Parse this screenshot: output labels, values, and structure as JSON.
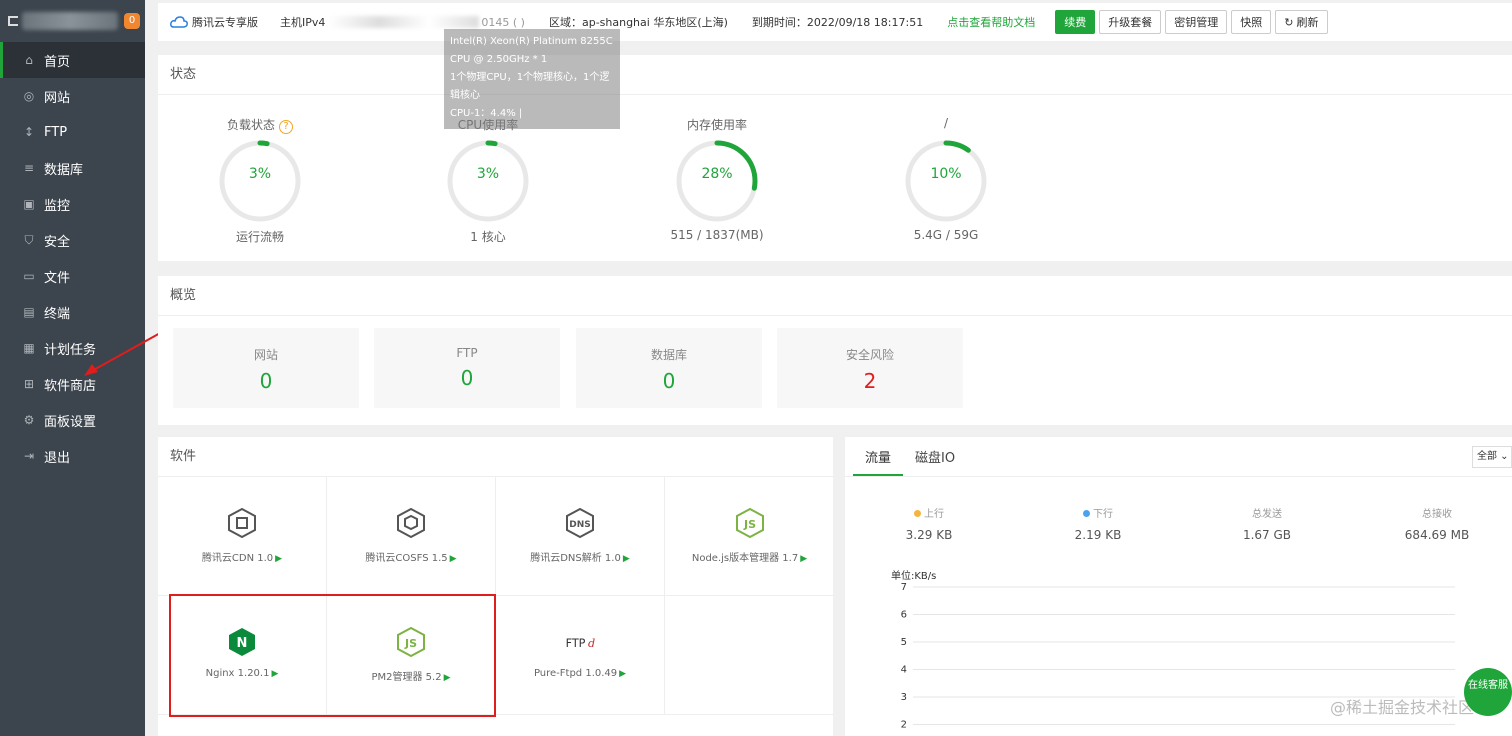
{
  "sidebar": {
    "badge": "0",
    "items": [
      {
        "label": "首页",
        "icon": "home-icon",
        "active": true
      },
      {
        "label": "网站",
        "icon": "globe-icon"
      },
      {
        "label": "FTP",
        "icon": "ftp-icon"
      },
      {
        "label": "数据库",
        "icon": "database-icon"
      },
      {
        "label": "监控",
        "icon": "monitor-icon"
      },
      {
        "label": "安全",
        "icon": "shield-icon"
      },
      {
        "label": "文件",
        "icon": "folder-icon"
      },
      {
        "label": "终端",
        "icon": "terminal-icon"
      },
      {
        "label": "计划任务",
        "icon": "calendar-icon"
      },
      {
        "label": "软件商店",
        "icon": "grid-icon"
      },
      {
        "label": "面板设置",
        "icon": "gear-icon"
      },
      {
        "label": "退出",
        "icon": "logout-icon"
      }
    ]
  },
  "topbar": {
    "version": "腾讯云专享版",
    "ip_label": "主机IPv4",
    "ip_tail": "0145 (        )",
    "region": "区域：ap-shanghai 华东地区(上海)",
    "expire": "到期时间：2022/09/18 18:17:51",
    "help": "点击查看帮助文档",
    "buttons": [
      "续费",
      "升级套餐",
      "密钥管理",
      "快照",
      "刷新"
    ]
  },
  "status": {
    "title": "状态",
    "gauges": [
      {
        "label": "负载状态",
        "value": "3%",
        "percent": 3,
        "sub": "运行流畅",
        "help": "?"
      },
      {
        "label": "CPU使用率",
        "value": "3%",
        "percent": 3,
        "sub": "1 核心"
      },
      {
        "label": "内存使用率",
        "value": "28%",
        "percent": 28,
        "sub": "515 / 1837(MB)"
      },
      {
        "label": "/",
        "value": "10%",
        "percent": 10,
        "sub": "5.4G / 59G"
      }
    ],
    "tooltip": [
      "Intel(R) Xeon(R) Platinum 8255C",
      "CPU @ 2.50GHz * 1",
      "1个物理CPU，1个物理核心，1个逻",
      "辑核心",
      "CPU-1：4.4% |"
    ]
  },
  "overview": {
    "title": "概览",
    "cards": [
      {
        "label": "网站",
        "value": "0"
      },
      {
        "label": "FTP",
        "value": "0"
      },
      {
        "label": "数据库",
        "value": "0"
      },
      {
        "label": "安全风险",
        "value": "2",
        "danger": true
      }
    ]
  },
  "software": {
    "title": "软件",
    "items": [
      {
        "name": "腾讯云CDN 1.0",
        "icon": "cdn-icon"
      },
      {
        "name": "腾讯云COSFS 1.5",
        "icon": "cosfs-icon"
      },
      {
        "name": "腾讯云DNS解析 1.0",
        "icon": "dns-icon"
      },
      {
        "name": "Node.js版本管理器 1.7",
        "icon": "nodejs-icon"
      },
      {
        "name": "Nginx 1.20.1",
        "icon": "nginx-icon"
      },
      {
        "name": "PM2管理器 5.2",
        "icon": "pm2-icon"
      },
      {
        "name": "Pure-Ftpd 1.0.49",
        "icon": "ftpd-icon"
      },
      {
        "name": "",
        "icon": ""
      }
    ]
  },
  "traffic": {
    "tabs": [
      "流量",
      "磁盘IO"
    ],
    "select": "全部",
    "stats": [
      {
        "label": "上行",
        "value": "3.29 KB",
        "color": "#f5b342"
      },
      {
        "label": "下行",
        "value": "2.19 KB",
        "color": "#4aa3f0"
      },
      {
        "label": "总发送",
        "value": "1.67 GB"
      },
      {
        "label": "总接收",
        "value": "684.69 MB"
      }
    ],
    "unit": "单位:KB/s",
    "yticks": [
      "7",
      "6",
      "5",
      "4",
      "3",
      "2"
    ]
  },
  "watermark": "@稀土掘金技术社区",
  "ad": "在线客服",
  "colors": {
    "accent": "#20a53a",
    "danger": "#e01d1d",
    "sidebar": "#3c444d"
  }
}
